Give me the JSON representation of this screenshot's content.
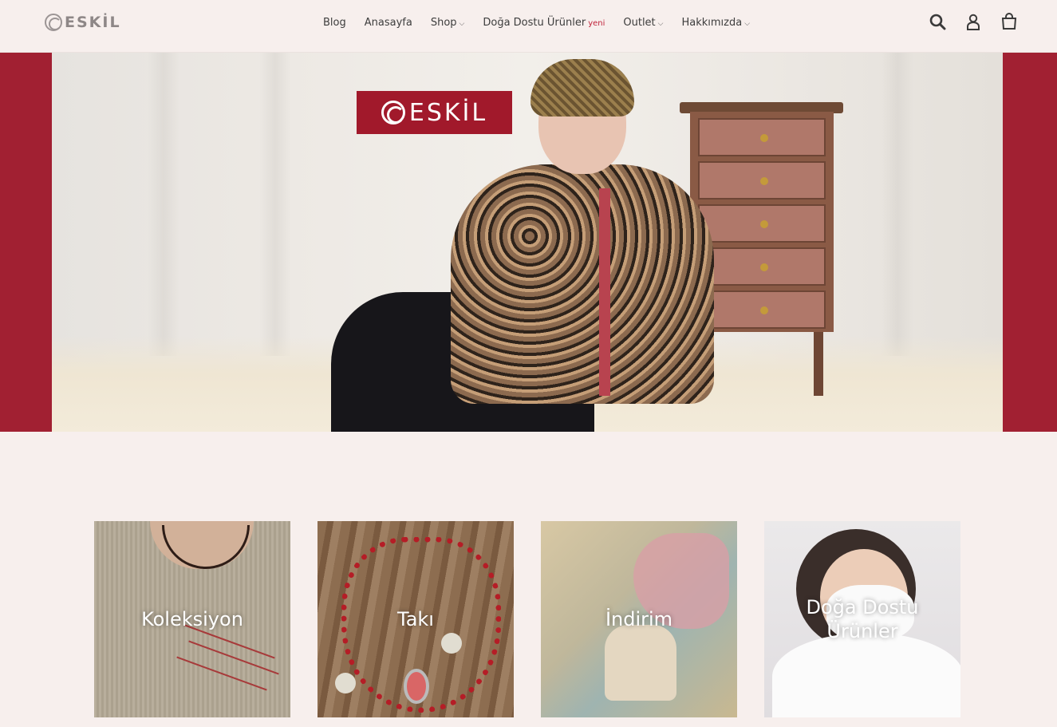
{
  "brand": {
    "name": "ESKİL"
  },
  "nav": {
    "items": [
      {
        "label": "Blog",
        "has_dropdown": false
      },
      {
        "label": "Anasayfa",
        "has_dropdown": false
      },
      {
        "label": "Shop",
        "has_dropdown": true
      },
      {
        "label": "Doğa Dostu Ürünler",
        "badge": "yeni",
        "has_dropdown": false
      },
      {
        "label": "Outlet",
        "has_dropdown": true
      },
      {
        "label": "Hakkımızda",
        "has_dropdown": true
      }
    ],
    "chevron": "⌵"
  },
  "header_icons": [
    "search-icon",
    "account-icon",
    "cart-icon"
  ],
  "hero": {
    "badge_text": "ESKİL",
    "background_color": "#a12032"
  },
  "collections": [
    {
      "label": "Koleksiyon"
    },
    {
      "label": "Takı"
    },
    {
      "label": "İndirim"
    },
    {
      "label": "Doğa Dostu Ürünler"
    }
  ],
  "colors": {
    "page_bg": "#f7efed",
    "accent": "#c0233b"
  }
}
